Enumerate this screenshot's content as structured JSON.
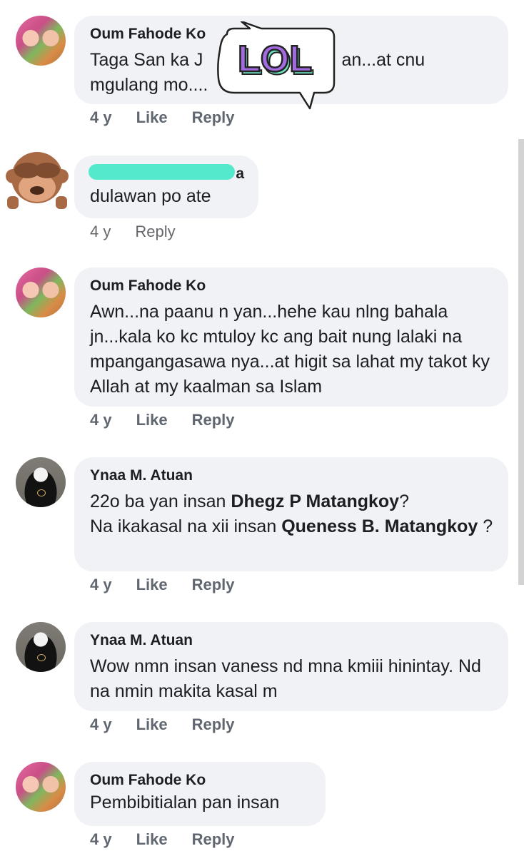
{
  "comments": [
    {
      "author": "Oum Fahode Ko",
      "text_pre": "Taga San ka J",
      "text_post": "an...at cnu",
      "text_line2": "mgulang mo....",
      "time": "4 y",
      "like": "Like",
      "reply": "Reply"
    },
    {
      "author_tail": "a",
      "text": "dulawan po ate",
      "time": "4 y",
      "reply": "Reply"
    },
    {
      "author": "Oum Fahode Ko",
      "text": "Awn...na paanu n yan...hehe kau nlng bahala jn...kala ko kc mtuloy kc ang bait nung lalaki na mpangangasawa nya...at higit sa lahat my takot ky Allah at my kaalman sa Islam",
      "time": "4 y",
      "like": "Like",
      "reply": "Reply"
    },
    {
      "author": "Ynaa M. Atuan",
      "text_a": "22o ba yan insan ",
      "mention1": "Dhegz P Matangkoy",
      "text_b": "?",
      "text_c": "Na ikakasal na xii insan ",
      "mention2": "Queness B. Matangkoy",
      "text_d": " ?",
      "time": "4 y",
      "like": "Like",
      "reply": "Reply"
    },
    {
      "author": "Ynaa M. Atuan",
      "text": "Wow nmn insan vaness nd mna kmiii hinintay. Nd na nmin makita kasal m",
      "time": "4 y",
      "like": "Like",
      "reply": "Reply"
    },
    {
      "author": "Oum Fahode Ko",
      "text": "Pembibitialan pan insan",
      "time": "4 y",
      "like": "Like",
      "reply": "Reply"
    }
  ],
  "sticker": {
    "label": "LOL",
    "fill": "#a36be0",
    "shadow": "#6fe0c0"
  },
  "colors": {
    "bubble": "#f0f2f5",
    "meta": "#606770",
    "redaction": "#54e8cd"
  }
}
